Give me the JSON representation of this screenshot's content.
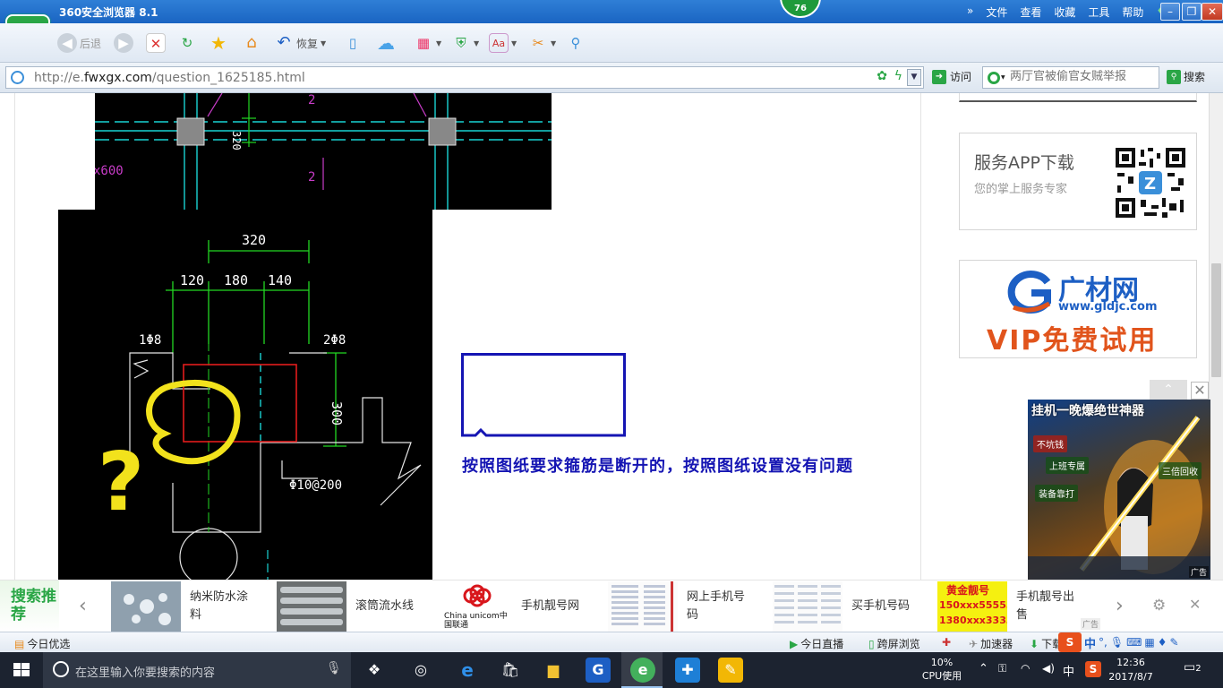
{
  "browser": {
    "title": "360安全浏览器 8.1",
    "badge_count": "76",
    "menu": [
      "文件",
      "查看",
      "收藏",
      "工具",
      "帮助"
    ],
    "toolbar": {
      "back_label": "后退",
      "restore_label": "恢复"
    },
    "address": {
      "url_prefix": "http://e.",
      "url_domain": "fwxgx.com",
      "url_path": "/question_1625185.html"
    },
    "visit_label": "访问",
    "search": {
      "placeholder": "两厅官被偷官女贼举报",
      "button_label": "搜索"
    }
  },
  "cad": {
    "top_dims": {
      "dim_320": "320",
      "label_2a": "2",
      "label_2b": "2",
      "label_x600": "x600"
    },
    "main_dims": {
      "total": "320",
      "d1": "120",
      "d2": "180",
      "d3": "140",
      "rebar_left": "1Φ8",
      "rebar_right": "2Φ8",
      "height": "300",
      "stirrup": "Φ10@200",
      "question_mark": "?"
    }
  },
  "answer": {
    "text": "按照图纸要求箍筋是断开的，按照图纸设置没有问题"
  },
  "sidebar": {
    "app_download": {
      "title": "服务APP下载",
      "subtitle": "您的掌上服务专家"
    },
    "gldjc": {
      "name": "广材网",
      "url": "www.gldjc.com",
      "promo": "VIP免费试用"
    }
  },
  "game_ad": {
    "title": "挂机一晚爆绝世神器",
    "tags": [
      "不坑钱",
      "上班专属",
      "三倍回收",
      "装备靠打"
    ],
    "ad_label": "广告"
  },
  "recommend": {
    "label": "搜索推荐",
    "items": [
      {
        "text": "纳米防水涂料"
      },
      {
        "text": "滚筒流水线"
      },
      {
        "text": "手机靓号网"
      },
      {
        "text": "网上手机号码"
      },
      {
        "text": "买手机号码"
      },
      {
        "text": "手机靓号出售"
      }
    ],
    "chinaunicom_brand": "China unicom中国联通",
    "golden_number_title": "黄金靓号",
    "golden_numbers": [
      "150xxx55555",
      "1380xxx3333"
    ],
    "ad_label": "广告"
  },
  "statusbar": {
    "today_pick": "今日优选",
    "today_live": "今日直播",
    "cross_screen": "跨屏浏览",
    "accelerator": "加速器",
    "download": "下载",
    "ime_zh": "中"
  },
  "taskbar": {
    "search_placeholder": "在这里输入你要搜索的内容",
    "cpu_percent": "10%",
    "cpu_label": "CPU使用",
    "ime": "中",
    "time": "12:36",
    "date": "2017/8/7",
    "notification_count": "2"
  },
  "colors": {
    "browser_accent": "#2aa646",
    "title_bar": "#1a64c2",
    "answer_text": "#1515b3",
    "cad_bg": "#000000",
    "gldjc_blue": "#1d5fc4",
    "gldjc_orange": "#e1541c"
  }
}
